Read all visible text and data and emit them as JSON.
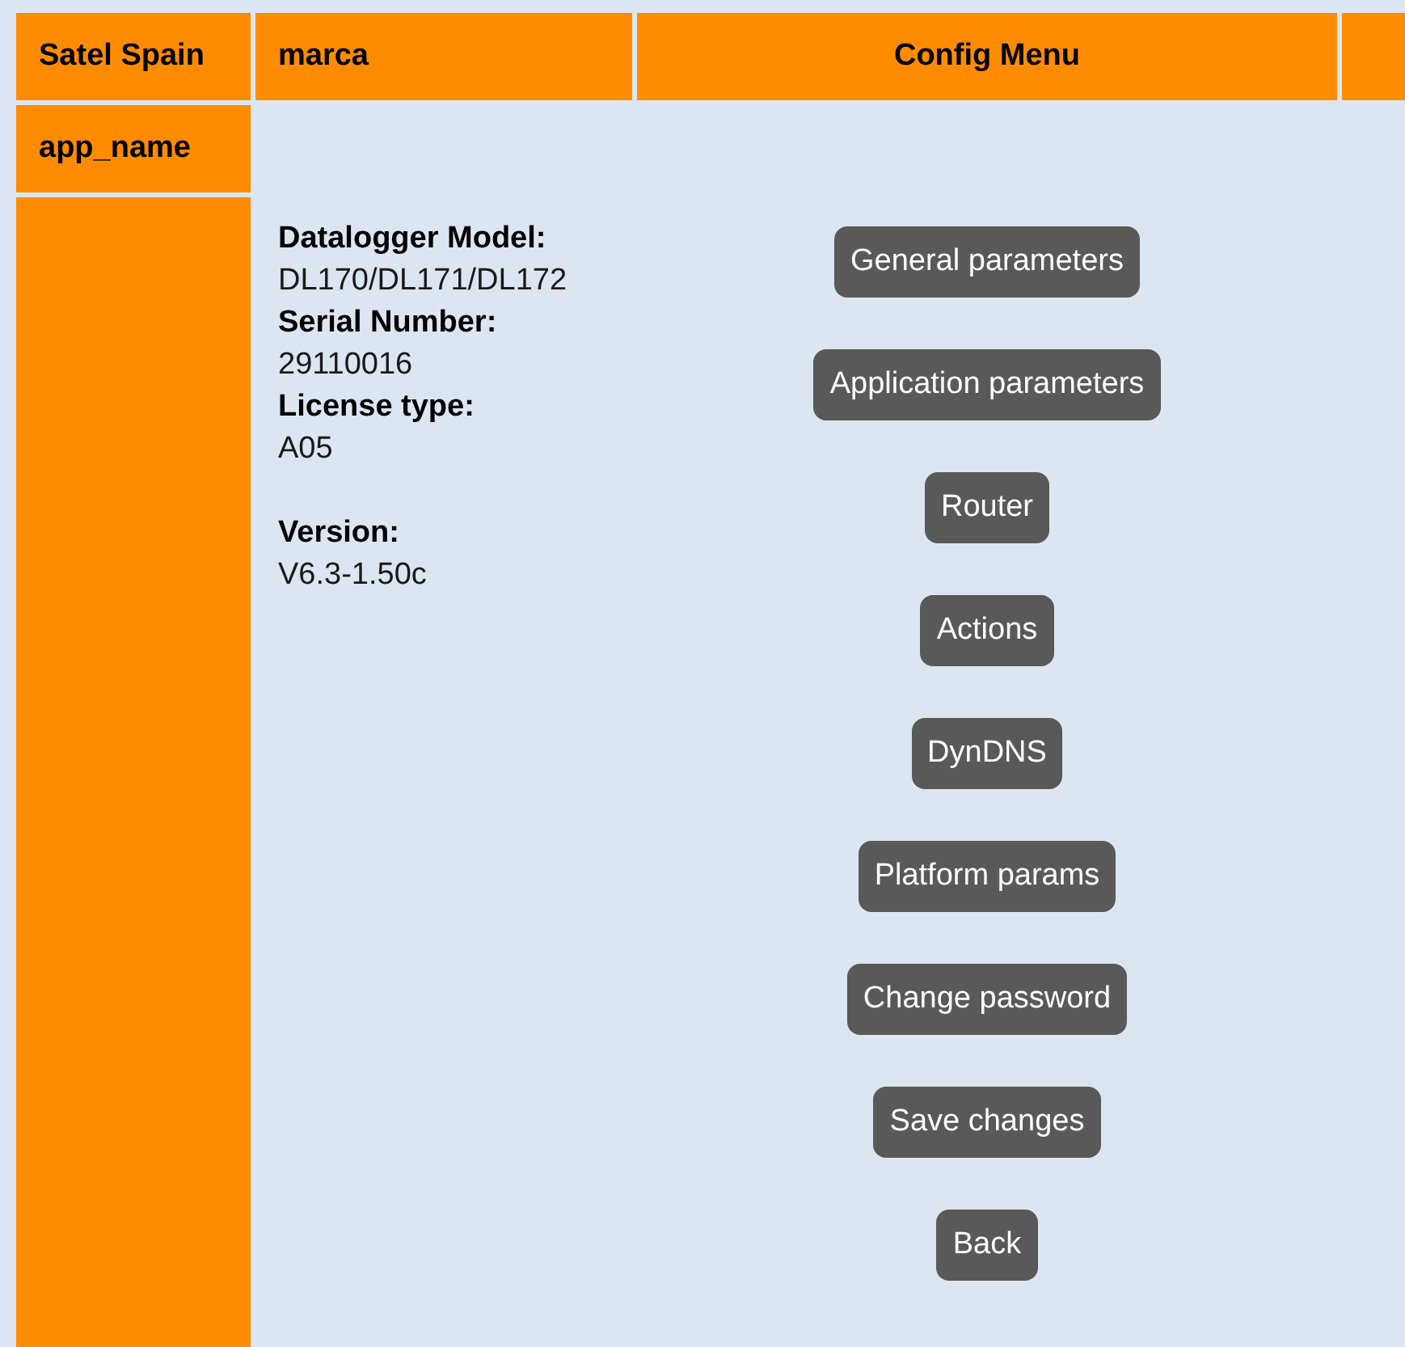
{
  "header": {
    "brand": "Satel Spain",
    "marca": "marca",
    "title": "Config Menu"
  },
  "sidebar": {
    "app_name": "app_name"
  },
  "device_info": [
    [
      {
        "label": "Datalogger Model:",
        "value": "DL170/DL171/DL172"
      },
      {
        "label": "Serial Number:",
        "value": "29110016"
      },
      {
        "label": "License type:",
        "value": "A05"
      }
    ],
    [
      {
        "label": "Version:",
        "value": "V6.3-1.50c"
      }
    ]
  ],
  "buttons": [
    "General parameters",
    "Application parameters",
    "Router",
    "Actions",
    "DynDNS",
    "Platform params",
    "Change password",
    "Save changes",
    "Back"
  ]
}
